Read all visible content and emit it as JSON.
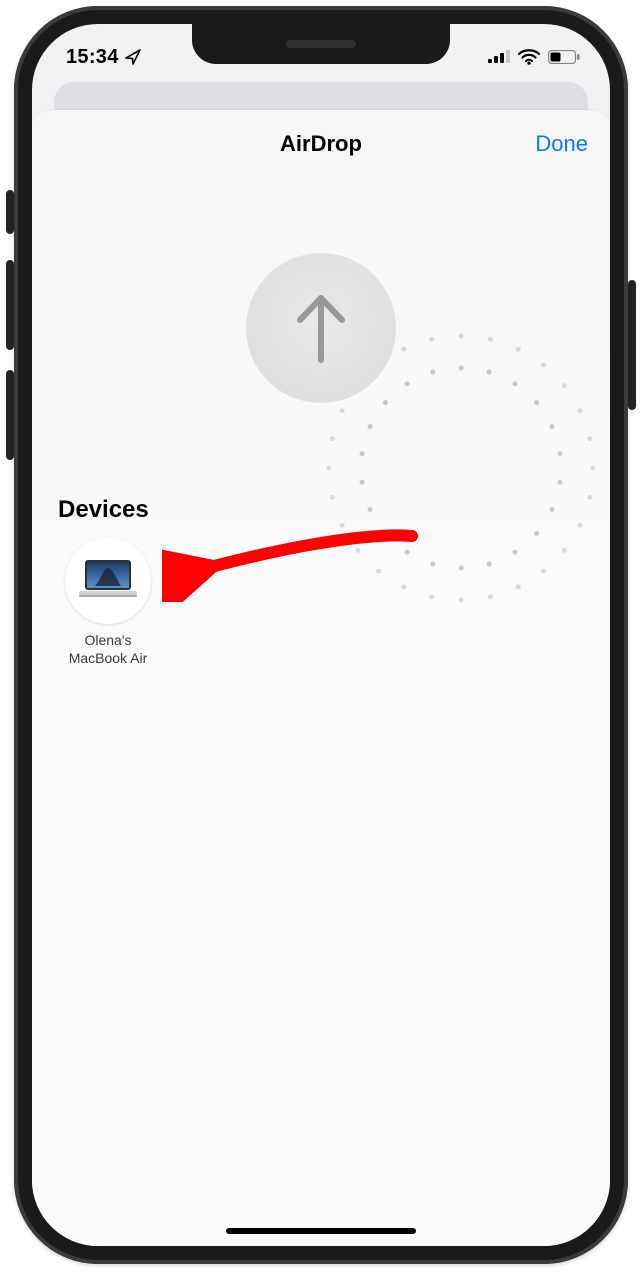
{
  "status": {
    "time": "15:34",
    "location_icon": "location-arrow-icon",
    "cellular_bars": 4,
    "wifi_bars": 3,
    "battery_pct": 40
  },
  "sheet": {
    "title": "AirDrop",
    "done_label": "Done"
  },
  "radar": {
    "icon": "arrow-up-icon"
  },
  "sections": {
    "devices_label": "Devices"
  },
  "devices": [
    {
      "name": "Olena's\nMacBook Air",
      "type": "macbook"
    }
  ],
  "annotation": {
    "arrow_color": "#ff0000"
  }
}
